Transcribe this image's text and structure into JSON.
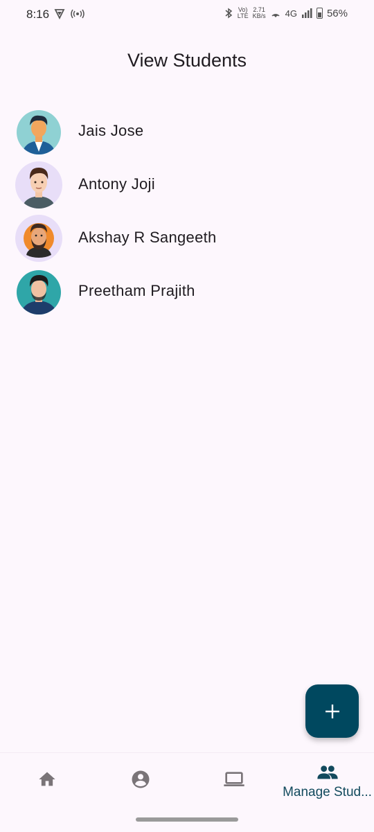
{
  "status_bar": {
    "time": "8:16",
    "volte_top": "Vo)",
    "volte_bottom": "LTE",
    "speed_value": "2.71",
    "speed_unit": "KB/s",
    "network": "4G",
    "battery": "56%"
  },
  "page": {
    "title": "View Students"
  },
  "students": [
    {
      "name": "Jais Jose"
    },
    {
      "name": "Antony Joji"
    },
    {
      "name": "Akshay R Sangeeth"
    },
    {
      "name": "Preetham Prajith"
    }
  ],
  "fab": {
    "icon": "plus-icon"
  },
  "bottom_nav": {
    "items": [
      {
        "icon": "home-icon",
        "label": ""
      },
      {
        "icon": "account-circle-icon",
        "label": ""
      },
      {
        "icon": "laptop-icon",
        "label": ""
      },
      {
        "icon": "people-icon",
        "label": "Manage Stud..."
      }
    ],
    "active_index": 3,
    "active_color": "#124a5d",
    "inactive_color": "#7a7478"
  },
  "colors": {
    "background": "#fdf7fd",
    "fab": "#00485f"
  }
}
